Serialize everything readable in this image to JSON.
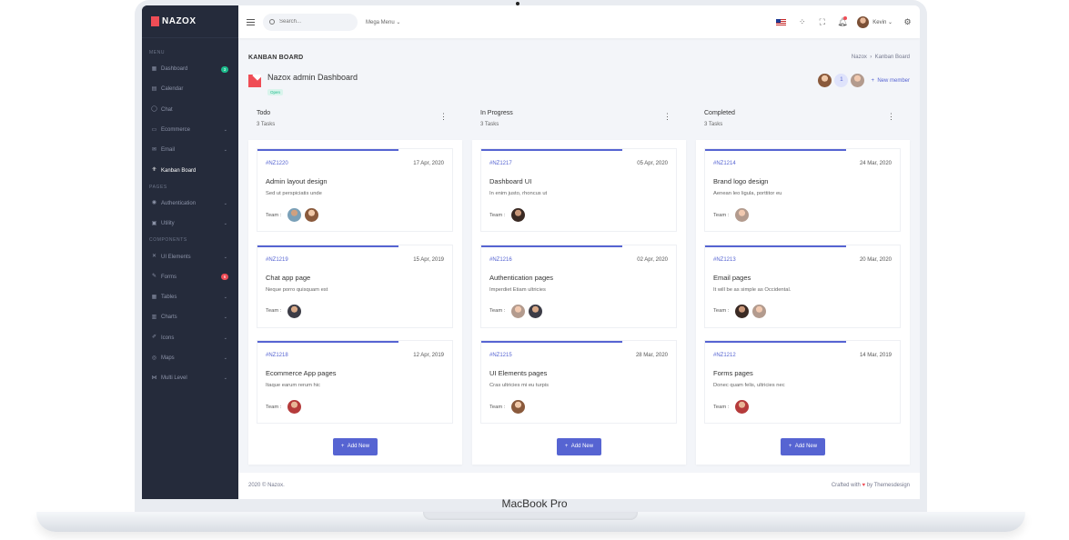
{
  "brand": {
    "name": "NAZOX"
  },
  "device_label": "MacBook Pro",
  "sidebar": {
    "sections": [
      {
        "title": "MENU",
        "items": [
          {
            "label": "Dashboard",
            "icon": "dashboard-icon",
            "badge": "3",
            "badge_color": "#1cbb8c"
          },
          {
            "label": "Calendar",
            "icon": "calendar-icon"
          },
          {
            "label": "Chat",
            "icon": "chat-icon"
          },
          {
            "label": "Ecommerce",
            "icon": "store-icon",
            "chevron": true
          },
          {
            "label": "Email",
            "icon": "mail-icon",
            "chevron": true
          },
          {
            "label": "Kanban Board",
            "icon": "kanban-icon",
            "active": true
          }
        ]
      },
      {
        "title": "PAGES",
        "items": [
          {
            "label": "Authentication",
            "icon": "account-icon",
            "chevron": true
          },
          {
            "label": "Utility",
            "icon": "utility-icon",
            "chevron": true
          }
        ]
      },
      {
        "title": "COMPONENTS",
        "items": [
          {
            "label": "UI Elements",
            "icon": "tools-icon",
            "chevron": true
          },
          {
            "label": "Forms",
            "icon": "forms-icon",
            "badge": "6",
            "badge_color": "#ef4d56"
          },
          {
            "label": "Tables",
            "icon": "table-icon",
            "chevron": true
          },
          {
            "label": "Charts",
            "icon": "chart-icon",
            "chevron": true
          },
          {
            "label": "Icons",
            "icon": "brush-icon",
            "chevron": true
          },
          {
            "label": "Maps",
            "icon": "map-pin-icon",
            "chevron": true
          },
          {
            "label": "Multi Level",
            "icon": "share-icon",
            "chevron": true
          }
        ]
      }
    ]
  },
  "topbar": {
    "search_placeholder": "Search...",
    "mega_menu": "Mega Menu",
    "user_name": "Kevin"
  },
  "page": {
    "title": "KANBAN BOARD",
    "breadcrumb": [
      "Nazox",
      "Kanban Board"
    ],
    "project_name": "Nazox admin Dashboard",
    "project_status": "Open",
    "member_count": "1",
    "new_member": "New member"
  },
  "columns": [
    {
      "title": "Todo",
      "count": "3 Tasks",
      "add_label": "Add New",
      "cards": [
        {
          "id": "#NZ1220",
          "date": "17 Apr, 2020",
          "title": "Admin layout design",
          "desc": "Sed ut perspiciatis unde",
          "team_label": "Team :",
          "team": [
            "av-e",
            "av-a"
          ]
        },
        {
          "id": "#NZ1219",
          "date": "15 Apr, 2019",
          "title": "Chat app page",
          "desc": "Neque porro quisquam est",
          "team_label": "Team :",
          "team": [
            "av-b"
          ]
        },
        {
          "id": "#NZ1218",
          "date": "12 Apr, 2019",
          "title": "Ecommerce App pages",
          "desc": "Itaque earum rerum hic",
          "team_label": "Team :",
          "team": [
            "av-c"
          ]
        }
      ]
    },
    {
      "title": "In Progress",
      "count": "3 Tasks",
      "add_label": "Add New",
      "cards": [
        {
          "id": "#NZ1217",
          "date": "05 Apr, 2020",
          "title": "Dashboard UI",
          "desc": "In enim justo, rhoncus ut",
          "team_label": "Team :",
          "team": [
            "av-f"
          ]
        },
        {
          "id": "#NZ1216",
          "date": "02 Apr, 2020",
          "title": "Authentication pages",
          "desc": "Imperdiet Etiam ultricies",
          "team_label": "Team :",
          "team": [
            "av-d",
            "av-b"
          ]
        },
        {
          "id": "#NZ1215",
          "date": "28 Mar, 2020",
          "title": "UI Elements pages",
          "desc": "Cras ultricies mi eu turpis",
          "team_label": "Team :",
          "team": [
            "av-a"
          ]
        }
      ]
    },
    {
      "title": "Completed",
      "count": "3 Tasks",
      "add_label": "Add New",
      "cards": [
        {
          "id": "#NZ1214",
          "date": "24 Mar, 2020",
          "title": "Brand logo design",
          "desc": "Aenean leo ligula, porttitor eu",
          "team_label": "Team :",
          "team": [
            "av-d"
          ]
        },
        {
          "id": "#NZ1213",
          "date": "20 Mar, 2020",
          "title": "Email pages",
          "desc": "It will be as simple as Occidental.",
          "team_label": "Team :",
          "team": [
            "av-f",
            "av-d"
          ]
        },
        {
          "id": "#NZ1212",
          "date": "14 Mar, 2019",
          "title": "Forms pages",
          "desc": "Donec quam felis, ultricies nec",
          "team_label": "Team :",
          "team": [
            "av-c"
          ]
        }
      ]
    }
  ],
  "footer": {
    "left": "2020 © Nazox.",
    "right_pre": "Crafted with",
    "right_post": "by Themesdesign"
  },
  "colors": {
    "primary": "#5664d2",
    "sidebar": "#252b3b",
    "danger": "#ef4d56",
    "success": "#1cbb8c"
  }
}
